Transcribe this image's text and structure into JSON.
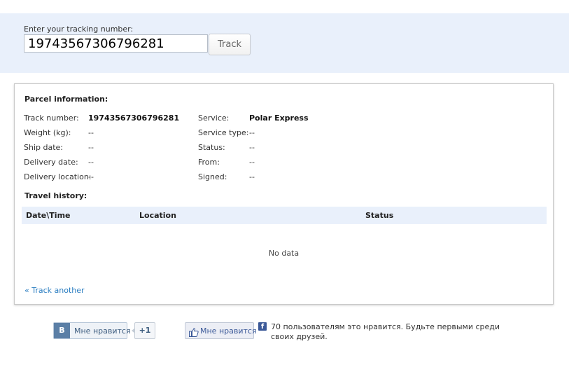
{
  "search": {
    "label": "Enter your tracking number:",
    "value": "19743567306796281",
    "button_label": "Track"
  },
  "parcel": {
    "title": "Parcel information:",
    "left_fields": [
      {
        "label": "Track number:",
        "value": "19743567306796281"
      },
      {
        "label": "Weight (kg):",
        "value": "--"
      },
      {
        "label": "Ship date:",
        "value": "--"
      },
      {
        "label": "Delivery date:",
        "value": "--"
      },
      {
        "label": "Delivery location:",
        "value": "--"
      }
    ],
    "right_fields": [
      {
        "label": "Service:",
        "value": "Polar Express"
      },
      {
        "label": "Service type:",
        "value": "--"
      },
      {
        "label": "Status:",
        "value": "--"
      },
      {
        "label": "From:",
        "value": "--"
      },
      {
        "label": "Signed:",
        "value": "--"
      }
    ]
  },
  "history": {
    "title": "Travel history:",
    "columns": [
      "Date\\Time",
      "Location",
      "Status"
    ],
    "empty_text": "No data"
  },
  "track_another_label": "« Track another",
  "social": {
    "vk_logo": "B",
    "vk_like_label": "Мне нравится",
    "vk_count": "+1",
    "fb_like_label": "Мне нравится",
    "fb_icon": "f",
    "fb_social_text": "70 пользователям это нравится. Будьте первыми среди своих друзей."
  },
  "colors": {
    "band_background": "#e9f0fb",
    "link": "#2a7dc1",
    "vk_brand": "#5b7fa6",
    "fb_brand": "#3b5998"
  },
  "icons": {
    "vk": "vk-logo-icon",
    "fb_thumb": "thumbs-up-icon",
    "fb": "facebook-icon"
  }
}
